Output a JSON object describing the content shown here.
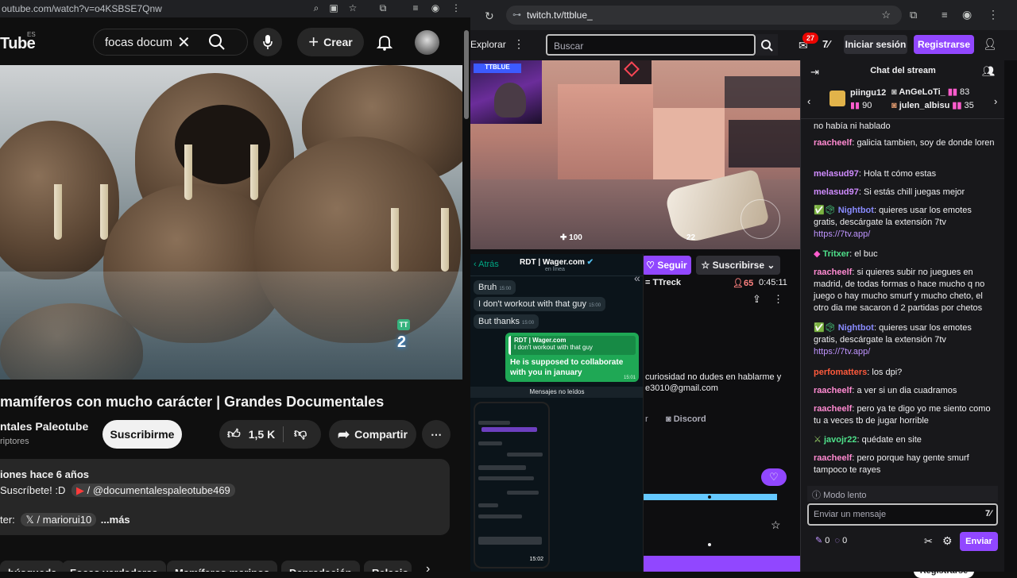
{
  "youtube": {
    "url": "outube.com/watch?v=o4KSBSE7Qnw",
    "logo": "Tube",
    "logo_region": "ES",
    "search_value": "focas docum",
    "create_label": "Crear",
    "video_badge": "2",
    "title": "mamíferos con mucho carácter | Grandes Documentales",
    "channel_name": "ntales Paleotube",
    "channel_subs": "riptores",
    "subscribe_label": "Suscribirme",
    "likes": "1,5 K",
    "share_label": "Compartir",
    "desc_line1": "iones  hace 6 años",
    "desc_line2_prefix": "Suscríbete! :D",
    "desc_line2_handle": "/ @documentalespaleotube469",
    "desc_line3_prefix": "ter:",
    "desc_line3_handle": "/ mariorui10",
    "more_label": "...más",
    "chips": [
      "búsqueda",
      "Focas verdaderas",
      "Mamíferos marinos",
      "Depredación",
      "Relacio"
    ]
  },
  "twitch": {
    "url": "twitch.tv/ttblue_",
    "explore_label": "Explorar",
    "search_placeholder": "Buscar",
    "notif_count": "27",
    "login_label": "Iniciar sesión",
    "register_label": "Registrarse",
    "follow_label": "Seguir",
    "subscribe_label": "Suscribirse",
    "game_title": "= TTreck",
    "viewers": "65",
    "uptime": "0:45:11",
    "hud_health": "100",
    "hud_ammo": "22",
    "about_text1": "curiosidad no dudes en hablarme y",
    "about_text2": "e3010@gmail.com",
    "link_partial": "r",
    "discord_label": "Discord",
    "bottom_register": "Registrarse",
    "chat": {
      "title": "Chat del stream",
      "gifters": [
        {
          "name": "piingu12",
          "count": "90"
        },
        {
          "name": "AnGeLoTi_",
          "count": "83"
        },
        {
          "name": "julen_albisu",
          "count": "35"
        }
      ],
      "messages": [
        {
          "user": "",
          "text": "no había ni hablado",
          "color": "#efeff1"
        },
        {
          "user": "raacheelf",
          "text": "galicia tambien, soy de donde loren",
          "color": "#ff8ad1"
        },
        {
          "user": "melasud97",
          "text": "Hola tt cómo estas",
          "color": "#d08cff"
        },
        {
          "user": "melasud97",
          "text": "Si estás chill juegas mejor",
          "color": "#d08cff"
        },
        {
          "user": "Nightbot",
          "text": "quieres usar los emotes gratis, descárgate la extensión 7tv",
          "link": "https://7tv.app/",
          "color": "#8a8cff"
        },
        {
          "user": "Tritxer",
          "text": "el buc",
          "color": "#4ee08a"
        },
        {
          "user": "raacheelf",
          "text": "si quieres subir no juegues en madrid, de todas formas o hace mucho q no juego o hay mucho smurf y mucho cheto, el otro dia me sacaron d 2 partidas por chetos",
          "color": "#ff8ad1"
        },
        {
          "user": "Nightbot",
          "text": "quieres usar los emotes gratis, descárgate la extensión 7tv",
          "link": "https://7tv.app/",
          "color": "#8a8cff"
        },
        {
          "user": "perfomatters",
          "text": "los dpi?",
          "color": "#ff5a3c"
        },
        {
          "user": "raacheelf",
          "text": "a ver si un dia cuadramos",
          "color": "#ff8ad1"
        },
        {
          "user": "raacheelf",
          "text": "pero ya te digo yo me siento como tu a veces tb de jugar horrible",
          "color": "#ff8ad1"
        },
        {
          "user": "javojr22",
          "text": "quédate en site",
          "color": "#4ee08a"
        },
        {
          "user": "raacheelf",
          "text": "pero porque hay gente smurf tampoco te rayes",
          "color": "#ff8ad1"
        }
      ],
      "slow_mode": "Modo lento",
      "input_placeholder": "Enviar un mensaje",
      "points1": "0",
      "points2": "0",
      "send_label": "Enviar"
    }
  },
  "whatsapp": {
    "back_label": "Atrás",
    "contact": "RDT | Wager.com",
    "status": "en línea",
    "messages_in": [
      {
        "text": "Bruh",
        "time": "15:00"
      },
      {
        "text": "I don't workout with that guy",
        "time": "15:00"
      },
      {
        "text": "But thanks",
        "time": "15:00"
      }
    ],
    "reply": {
      "quote_name": "RDT | Wager.com",
      "quote_text": "I don't workout with that guy",
      "text": "He is supposed to collaborate with you in january",
      "time": "15:01"
    },
    "unread_label": "Mensajes no leídos",
    "phone_time": "15:02"
  },
  "colors": {
    "twitch_purple": "#9147ff",
    "whatsapp_green": "#1fa855",
    "youtube_bg": "#0f0f0f"
  }
}
